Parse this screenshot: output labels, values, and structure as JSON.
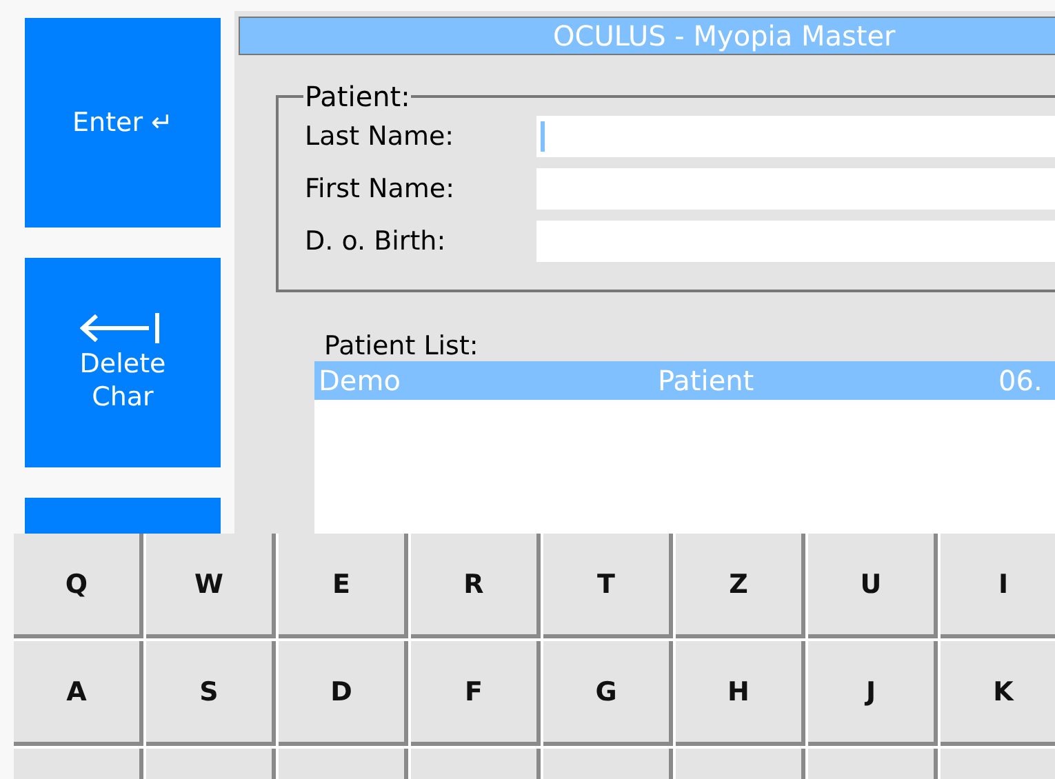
{
  "side_buttons": [
    {
      "kind": "enter",
      "label": "Enter ↵"
    },
    {
      "kind": "delete",
      "label": "Delete Char"
    },
    {
      "kind": "blank"
    }
  ],
  "window": {
    "title": "OCULUS - Myopia Master"
  },
  "patient": {
    "legend": "Patient:",
    "fields": [
      {
        "label": "Last Name:",
        "focused": true
      },
      {
        "label": "First Name:",
        "focused": false
      },
      {
        "label": "D. o. Birth:",
        "focused": false
      }
    ]
  },
  "patient_list": {
    "label": "Patient List:",
    "rows": [
      {
        "last_name": "Demo",
        "first_name": "Patient",
        "date": "06.",
        "selected": true
      }
    ]
  },
  "keyboard": {
    "rows": [
      {
        "keys": [
          {
            "kind": "letter",
            "label": "Q"
          },
          {
            "kind": "letter",
            "label": "W"
          },
          {
            "kind": "letter",
            "label": "E"
          },
          {
            "kind": "letter",
            "label": "R"
          },
          {
            "kind": "letter",
            "label": "T"
          },
          {
            "kind": "letter",
            "label": "Z"
          },
          {
            "kind": "letter",
            "label": "U"
          },
          {
            "kind": "letter",
            "label": "I"
          }
        ]
      },
      {
        "keys": [
          {
            "kind": "letter",
            "label": "A"
          },
          {
            "kind": "letter",
            "label": "S"
          },
          {
            "kind": "letter",
            "label": "D"
          },
          {
            "kind": "letter",
            "label": "F"
          },
          {
            "kind": "letter",
            "label": "G"
          },
          {
            "kind": "letter",
            "label": "H"
          },
          {
            "kind": "letter",
            "label": "J"
          },
          {
            "kind": "letter",
            "label": "K"
          }
        ]
      },
      {
        "keys": [
          {
            "kind": "blank"
          },
          {
            "kind": "blank"
          },
          {
            "kind": "blank"
          },
          {
            "kind": "blank"
          },
          {
            "kind": "blank"
          },
          {
            "kind": "blank"
          },
          {
            "kind": "blank"
          },
          {
            "kind": "blank"
          }
        ]
      }
    ]
  }
}
